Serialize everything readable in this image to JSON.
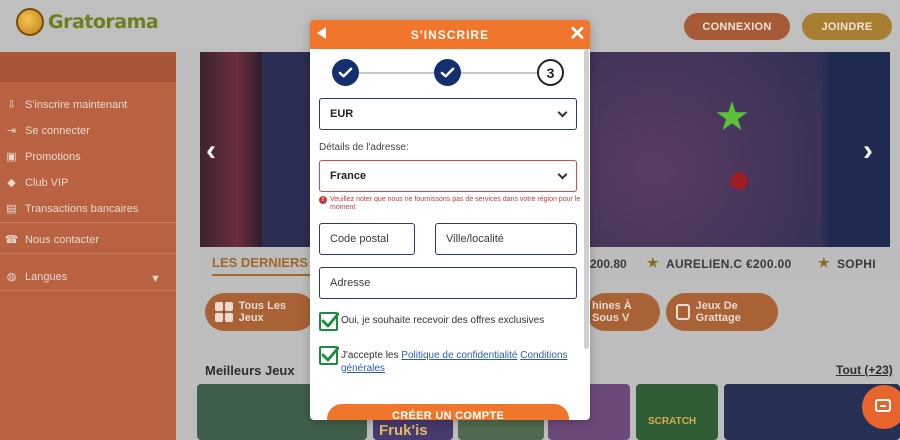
{
  "site": {
    "logo_text": "Gratorama",
    "header_buttons": {
      "login": "CONNEXION",
      "join": "JOINDRE"
    }
  },
  "sidebar": {
    "items": [
      {
        "label": "S'inscrire maintenant",
        "icon": "signup-icon"
      },
      {
        "label": "Se connecter",
        "icon": "login-icon"
      },
      {
        "label": "Promotions",
        "icon": "gift-icon"
      },
      {
        "label": "Club VIP",
        "icon": "diamond-icon"
      },
      {
        "label": "Transactions bancaires",
        "icon": "bank-icon"
      },
      {
        "label": "Nous contacter",
        "icon": "phone-icon"
      },
      {
        "label": "Langues",
        "icon": "globe-icon"
      }
    ]
  },
  "winners": {
    "title": "LES DERNIERS",
    "entries": [
      "200.80",
      "AURELIEN.C €200.00",
      "SOPHI"
    ]
  },
  "categories": {
    "all": "Tous Les Jeux",
    "slots": "hines À Sous V",
    "scratch": "Jeux De Grattage"
  },
  "games_section": {
    "title": "Meilleurs Jeux",
    "all_link": "Tout (+23)",
    "thumb_texts": [
      "Fruk'is",
      "SCRATCH"
    ]
  },
  "modal": {
    "title": "S'INSCRIRE",
    "current_step": "3",
    "currency": "EUR",
    "address_label": "Détails de l'adresse:",
    "country": "France",
    "warning": "Veuillez noter que nous ne fournissons pas de services dans votre région pour le moment",
    "postal_placeholder": "Code postal",
    "city_placeholder": "Ville/localité",
    "address_placeholder": "Adresse",
    "offers_label": "Oui, je souhaite recevoir des offres exclusives",
    "terms_prefix": "J'accepte les",
    "privacy_link": "Politique de confidentialité",
    "terms_link": "Conditions générales",
    "submit": "CRÉER UN COMPTE"
  },
  "colors": {
    "accent": "#f0762c",
    "step_done": "#142f6e",
    "checkbox": "#1b8c3a",
    "error": "#d84a4a"
  }
}
